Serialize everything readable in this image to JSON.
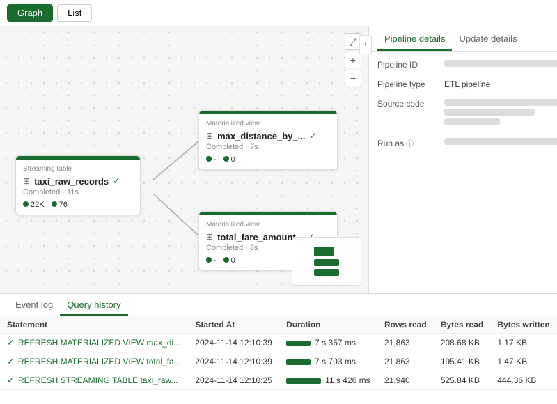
{
  "toolbar": {
    "tab_graph": "Graph",
    "tab_list": "List"
  },
  "panel_toggle": "›",
  "right_panel": {
    "tab_pipeline": "Pipeline details",
    "tab_update": "Update details",
    "fields": [
      {
        "label": "Pipeline ID",
        "type": "blurred"
      },
      {
        "label": "Pipeline type",
        "value": "ETL pipeline"
      },
      {
        "label": "Source code",
        "type": "blurred_multi"
      },
      {
        "label": "Run as",
        "type": "blurred_with_icon"
      }
    ]
  },
  "graph": {
    "streaming_node": {
      "type_label": "Streaming table",
      "icon": "⊞",
      "title": "taxi_raw_records",
      "status": "Completed · 11s",
      "metric1": "22K",
      "metric2": "76"
    },
    "mat_node1": {
      "type_label": "Materialized view",
      "icon": "⊞",
      "title": "max_distance_by_...",
      "status": "Completed · 7s",
      "metric1": "-",
      "metric2": "0"
    },
    "mat_node2": {
      "type_label": "Materialized view",
      "icon": "⊞",
      "title": "total_fare_amount...",
      "status": "Completed · 8s",
      "metric1": "-",
      "metric2": "0"
    }
  },
  "zoom": {
    "expand": "⤢",
    "plus": "+",
    "minus": "−"
  },
  "bottom": {
    "tab_event_log": "Event log",
    "tab_query_history": "Query history",
    "table": {
      "headers": [
        "Statement",
        "Started At",
        "Duration",
        "Rows read",
        "Bytes read",
        "Bytes written"
      ],
      "rows": [
        {
          "statement": "REFRESH MATERIALIZED VIEW max_di...",
          "started": "2024-11-14 12:10:39",
          "duration": "7 s 357 ms",
          "duration_bar": "medium",
          "rows_read": "21,863",
          "bytes_read": "208.68 KB",
          "bytes_written": "1.17 KB"
        },
        {
          "statement": "REFRESH MATERIALIZED VIEW total_fa...",
          "started": "2024-11-14 12:10:39",
          "duration": "7 s 703 ms",
          "duration_bar": "medium",
          "rows_read": "21,863",
          "bytes_read": "195.41 KB",
          "bytes_written": "1.47 KB"
        },
        {
          "statement": "REFRESH STREAMING TABLE taxi_raw...",
          "started": "2024-11-14 12:10:25",
          "duration": "11 s 426 ms",
          "duration_bar": "long",
          "rows_read": "21,940",
          "bytes_read": "525.84 KB",
          "bytes_written": "444.36 KB"
        }
      ]
    }
  }
}
